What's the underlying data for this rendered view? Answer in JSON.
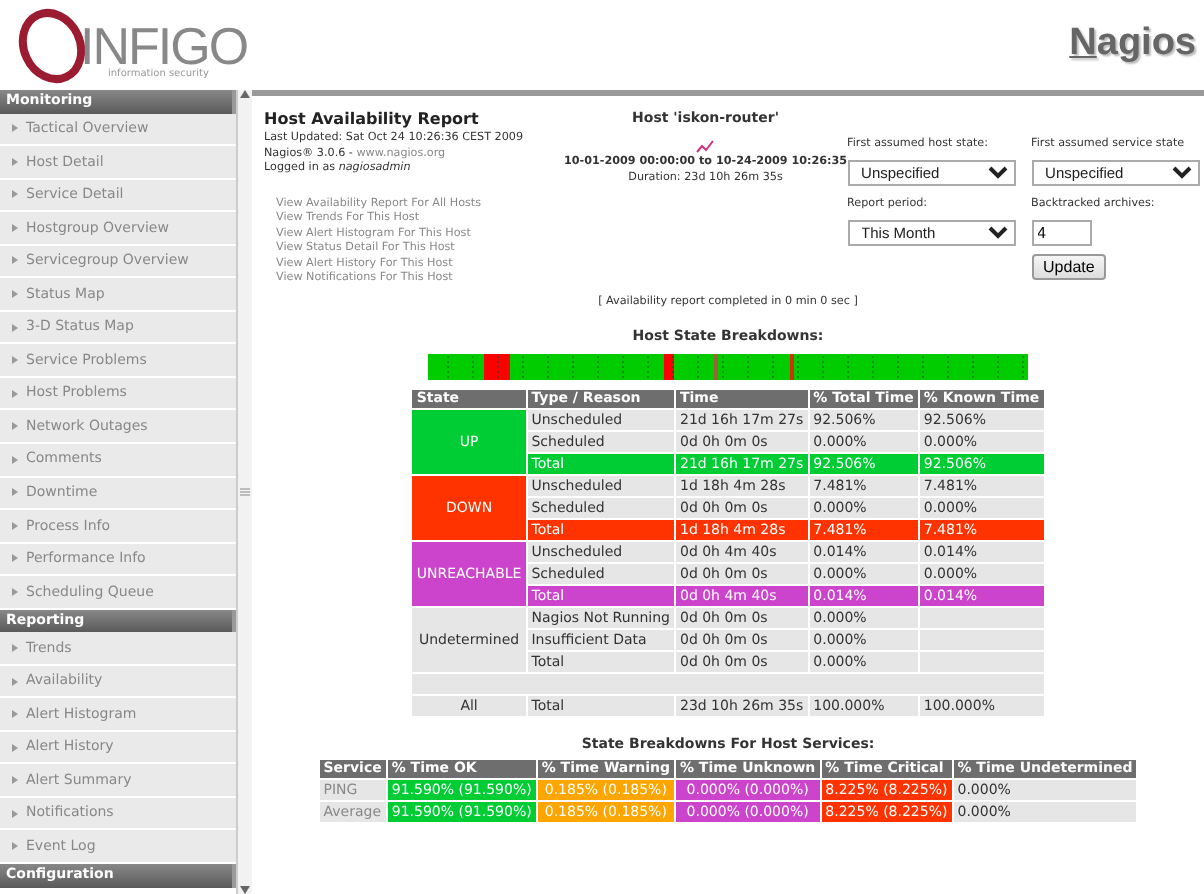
{
  "header": {
    "logo_text": "INFIGO",
    "logo_tagline": "information security",
    "product": "Nagios"
  },
  "sidebar": {
    "sections": [
      {
        "title": "Monitoring",
        "items": [
          "Tactical Overview",
          "Host Detail",
          "Service Detail",
          "Hostgroup Overview",
          "Servicegroup Overview",
          "Status Map",
          "3-D Status Map",
          "Service Problems",
          "Host Problems",
          "Network Outages",
          "Comments",
          "Downtime",
          "Process Info",
          "Performance Info",
          "Scheduling Queue"
        ]
      },
      {
        "title": "Reporting",
        "items": [
          "Trends",
          "Availability",
          "Alert Histogram",
          "Alert History",
          "Alert Summary",
          "Notifications",
          "Event Log"
        ]
      },
      {
        "title": "Configuration"
      }
    ]
  },
  "report": {
    "title": "Host Availability Report",
    "last_updated": "Last Updated: Sat Oct 24 10:26:36 CEST 2009",
    "version": "Nagios® 3.0.6 - ",
    "version_link": "www.nagios.org",
    "logged_in": "Logged in as *nagiosadmin*",
    "links": [
      "View Availability Report For All Hosts",
      "View Trends For This Host",
      "View Alert Histogram For This Host",
      "View Status Detail For This Host",
      "View Alert History For This Host",
      "View Notifications For This Host"
    ]
  },
  "host": {
    "title": "Host 'iskon-router'",
    "range": "10-01-2009 00:00:00 to 10-24-2009 10:26:35",
    "duration": "Duration: 23d 10h 26m 35s"
  },
  "form": {
    "host_state_label": "First assumed host state:",
    "host_state_value": "Unspecified",
    "service_state_label": "First assumed service state",
    "service_state_value": "Unspecified",
    "period_label": "Report period:",
    "period_value": "This Month",
    "archives_label": "Backtracked archives:",
    "archives_value": "4",
    "button": "Update"
  },
  "completed": "[ Availability report completed in 0 min 0 sec ]",
  "host_breakdown": {
    "title": "Host State Breakdowns:",
    "columns": [
      "State",
      "Type / Reason",
      "Time",
      "% Total Time",
      "% Known Time"
    ],
    "groups": [
      {
        "state": "UP",
        "kind": "up",
        "rows": [
          {
            "cells": [
              "Unscheduled",
              "21d 16h 17m 27s",
              "92.506%",
              "92.506%"
            ],
            "highlighted": false
          },
          {
            "cells": [
              "Scheduled",
              "0d 0h 0m 0s",
              "0.000%",
              "0.000%"
            ],
            "highlighted": false
          },
          {
            "cells": [
              "Total",
              "21d 16h 17m 27s",
              "92.506%",
              "92.506%"
            ],
            "highlighted": true
          }
        ]
      },
      {
        "state": "DOWN",
        "kind": "down",
        "rows": [
          {
            "cells": [
              "Unscheduled",
              "1d 18h 4m 28s",
              "7.481%",
              "7.481%"
            ],
            "highlighted": false
          },
          {
            "cells": [
              "Scheduled",
              "0d 0h 0m 0s",
              "0.000%",
              "0.000%"
            ],
            "highlighted": false
          },
          {
            "cells": [
              "Total",
              "1d 18h 4m 28s",
              "7.481%",
              "7.481%"
            ],
            "highlighted": true
          }
        ]
      },
      {
        "state": "UNREACHABLE",
        "kind": "unreachable",
        "rows": [
          {
            "cells": [
              "Unscheduled",
              "0d 0h 4m 40s",
              "0.014%",
              "0.014%"
            ],
            "highlighted": false
          },
          {
            "cells": [
              "Scheduled",
              "0d 0h 0m 0s",
              "0.000%",
              "0.000%"
            ],
            "highlighted": false
          },
          {
            "cells": [
              "Total",
              "0d 0h 4m 40s",
              "0.014%",
              "0.014%"
            ],
            "highlighted": true
          }
        ]
      },
      {
        "state": "Undetermined",
        "kind": "undetermined",
        "rows": [
          {
            "cells": [
              "Nagios Not Running",
              "0d 0h 0m 0s",
              "0.000%",
              ""
            ],
            "highlighted": false
          },
          {
            "cells": [
              "Insufficient Data",
              "0d 0h 0m 0s",
              "0.000%",
              ""
            ],
            "highlighted": false
          },
          {
            "cells": [
              "Total",
              "0d 0h 0m 0s",
              "0.000%",
              ""
            ],
            "highlighted": false
          }
        ]
      },
      {
        "state": "All",
        "kind": "all",
        "rows": [
          {
            "cells": [
              "Total",
              "23d 10h 26m 35s",
              "100.000%",
              "100.000%"
            ],
            "highlighted": false
          }
        ]
      }
    ]
  },
  "service_breakdown": {
    "title": "State Breakdowns For Host Services:",
    "columns": [
      {
        "label": "Service",
        "kind": "name"
      },
      {
        "label": "% Time OK",
        "kind": "ok"
      },
      {
        "label": "% Time Warning",
        "kind": "warning"
      },
      {
        "label": "% Time Unknown",
        "kind": "unknown"
      },
      {
        "label": "% Time Critical",
        "kind": "critical"
      },
      {
        "label": "% Time Undetermined",
        "kind": "plain"
      }
    ],
    "rows": [
      {
        "cells": [
          "PING",
          "91.590% (91.590%)",
          "0.185% (0.185%)",
          "0.000% (0.000%)",
          "8.225% (8.225%)",
          "0.000%"
        ]
      },
      {
        "cells": [
          "Average",
          "91.590% (91.590%)",
          "0.185% (0.185%)",
          "0.000% (0.000%)",
          "8.225% (8.225%)",
          "0.000%"
        ]
      }
    ]
  }
}
